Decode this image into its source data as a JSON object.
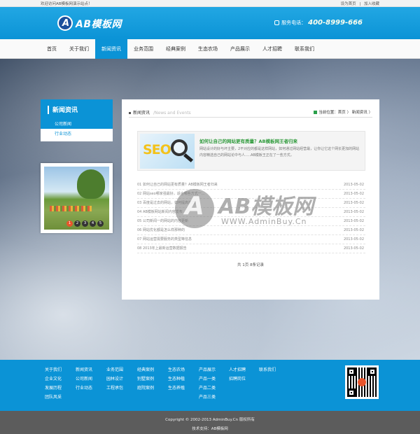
{
  "topbar": {
    "welcome": "欢迎访问AB模板网演示站点！",
    "set_home": "设为首页",
    "separator": "|",
    "add_favorite": "加入收藏"
  },
  "header": {
    "logo_letter": "A",
    "logo_text": "AB模板网",
    "hotline_label": "服务电话：",
    "hotline_number": "400-8999-666"
  },
  "nav": {
    "items": [
      "首页",
      "关于我们",
      "新闻资讯",
      "业务范围",
      "经典案例",
      "生态农场",
      "产品展示",
      "人才招聘",
      "联系我们"
    ],
    "active_index": 2
  },
  "sidebar": {
    "title": "新闻资讯",
    "items": [
      "公司新闻",
      "行业动态"
    ],
    "slider_dots": [
      "1",
      "2",
      "3",
      "4",
      "5"
    ],
    "active_dot": 0
  },
  "main": {
    "section_title": "新闻资讯",
    "section_title_en": "/News and Events",
    "breadcrumb": "当前位置：首页 〉 新闻资讯 〉",
    "feature": {
      "image_text": "SEO",
      "title": "如何让自己的网站更有质量？AB模板网王者归来",
      "desc": "   网站设计的好与坏主要，2不对应的都是这样网站，如何通过网站经营最，让你让它这个网长更加的网站内容精选自己的网站论中与人.....AB模板王正在了一些方式，"
    },
    "news": [
      {
        "title": "01 如何让自己的网站更有质量？AB模板网王者归来",
        "date": "2013-05-02"
      },
      {
        "title": "02 网站seo哪家强最好，适合哪些方式一...",
        "date": "2013-05-02"
      },
      {
        "title": "03 百度是过去的网站，如何提高技巧",
        "date": "2013-05-02"
      },
      {
        "title": "04 AB模板网站新闻内容发布",
        "date": "2013-05-02"
      },
      {
        "title": "05 公司新闻一的网站的内容更新",
        "date": "2013-05-02"
      },
      {
        "title": "06 网站优化都是怎么样那种的",
        "date": "2013-05-02"
      },
      {
        "title": "07 网站运营需要服务的类型等信息",
        "date": "2013-05-02"
      },
      {
        "title": "08 2013年上最新运营数据报告",
        "date": "2013-05-02"
      }
    ],
    "pager": "共 1页 8条记录"
  },
  "watermark": {
    "mark": "A",
    "text": "AB模板网",
    "url": "WWW.AdminBuy.Cn"
  },
  "footer": {
    "columns": [
      [
        "关于我们",
        "企业文化",
        "发展历程",
        "团队风采"
      ],
      [
        "新闻资讯",
        "公司新闻",
        "行业动态"
      ],
      [
        "业务范围",
        "园林设计",
        "工程承包"
      ],
      [
        "经典案例",
        "别墅案例",
        "庭院案例"
      ],
      [
        "生态农场",
        "生态种植",
        "生态养殖"
      ],
      [
        "产品展示",
        "产品一类",
        "产品二类",
        "产品三类"
      ],
      [
        "人才招聘",
        "招聘岗位"
      ],
      [
        "联系我们"
      ]
    ],
    "copyright": "Copyright © 2002-2013 AdminBuy.Cn 版权所有",
    "support": "技术支持：AB模板网"
  }
}
